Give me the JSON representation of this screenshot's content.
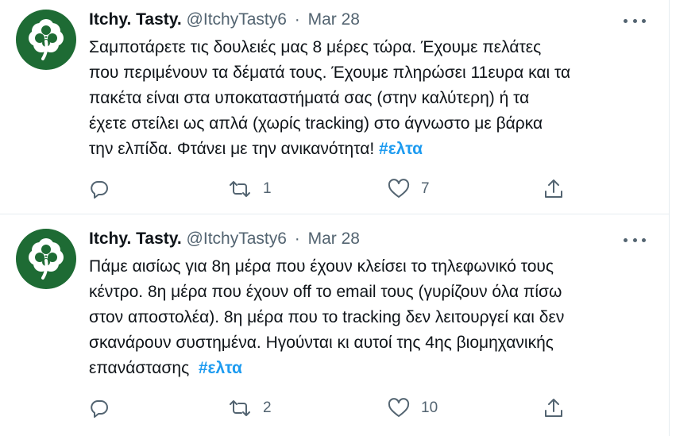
{
  "colors": {
    "hashtag": "#1d9bf0",
    "secondary_text": "#536471",
    "avatar_bg": "#1e6b34",
    "clover": "#ffffff"
  },
  "tweets": [
    {
      "display_name": "Itchy. Tasty.",
      "handle": "@ItchyTasty6",
      "separator": "·",
      "date": "Mar 28",
      "avatar_icon": "shamrock-icon",
      "lines": [
        "Σαμποτάρετε τις δουλειές μας 8 μέρες τώρα. Έχουμε πελάτες",
        "που περιμένουν τα δέματά τους. Έχουμε πληρώσει 11ευρα και τα",
        "πακέτα είναι στα υποκαταστήματά σας (στην καλύτερη) ή τα",
        "έχετε στείλει ως απλά (χωρίς tracking) στο άγνωστο με βάρκα",
        "την ελπίδα. Φτάνει με την ανικανότητα! "
      ],
      "hashtag": "#ελτα",
      "replies": "",
      "retweets": "1",
      "likes": "7"
    },
    {
      "display_name": "Itchy. Tasty.",
      "handle": "@ItchyTasty6",
      "separator": "·",
      "date": "Mar 28",
      "avatar_icon": "shamrock-icon",
      "lines": [
        "Πάμε αισίως για 8η μέρα που έχουν κλείσει το τηλεφωνικό τους",
        "κέντρο. 8η μέρα που έχουν off το email τους (γυρίζουν όλα πίσω",
        "στον αποστολέα). 8η μέρα που το tracking δεν λειτουργεί και δεν",
        "σκανάρουν συστημένα. Ηγούνται κι αυτοί της 4ης βιομηχανικής",
        "επανάστασης  "
      ],
      "hashtag": "#ελτα",
      "replies": "",
      "retweets": "2",
      "likes": "10"
    }
  ]
}
